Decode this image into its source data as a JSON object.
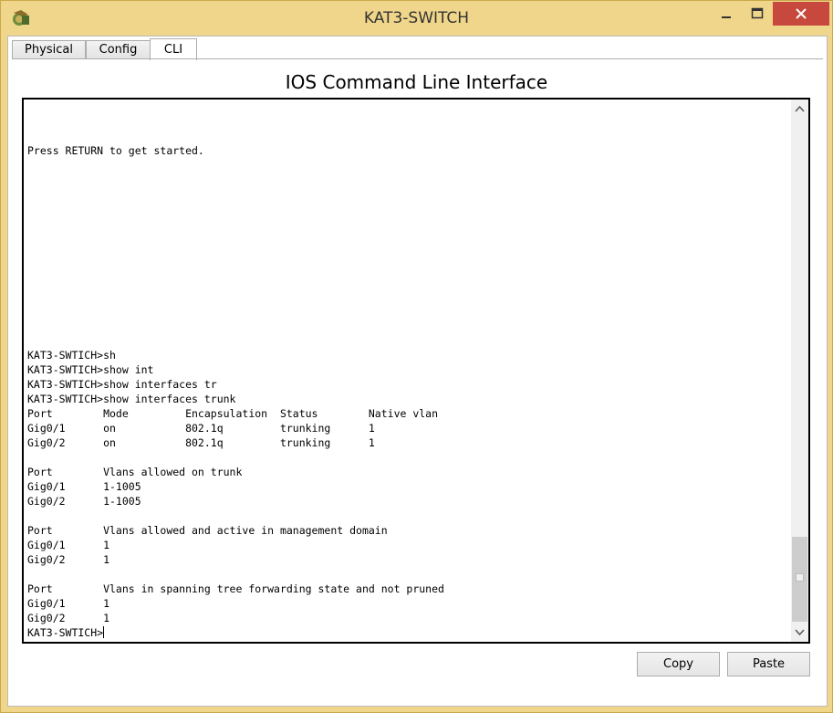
{
  "window": {
    "title": "KAT3-SWITCH",
    "icon": "packet-tracer-switch-icon"
  },
  "tabs": [
    {
      "label": "Physical",
      "active": false
    },
    {
      "label": "Config",
      "active": false
    },
    {
      "label": "CLI",
      "active": true
    }
  ],
  "heading": "IOS Command Line Interface",
  "terminal": {
    "lines": [
      "",
      "",
      "",
      "Press RETURN to get started.",
      "",
      "",
      "",
      "",
      "",
      "",
      "",
      "",
      "",
      "",
      "",
      "",
      "",
      "KAT3-SWTICH>sh",
      "KAT3-SWTICH>show int",
      "KAT3-SWTICH>show interfaces tr",
      "KAT3-SWTICH>show interfaces trunk",
      "Port        Mode         Encapsulation  Status        Native vlan",
      "Gig0/1      on           802.1q         trunking      1",
      "Gig0/2      on           802.1q         trunking      1",
      "",
      "Port        Vlans allowed on trunk",
      "Gig0/1      1-1005",
      "Gig0/2      1-1005",
      "",
      "Port        Vlans allowed and active in management domain",
      "Gig0/1      1",
      "Gig0/2      1",
      "",
      "Port        Vlans in spanning tree forwarding state and not pruned",
      "Gig0/1      1",
      "Gig0/2      1",
      "KAT3-SWTICH>"
    ]
  },
  "buttons": {
    "copy": "Copy",
    "paste": "Paste"
  },
  "colors": {
    "frame": "#f0d68a",
    "close_button": "#c7483c"
  }
}
